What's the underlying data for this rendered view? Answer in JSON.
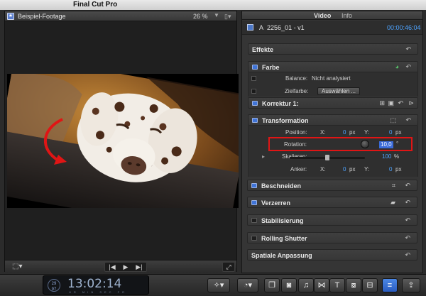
{
  "app": {
    "name": "Final Cut Pro"
  },
  "viewer": {
    "clip_name": "Beispiel-Footage",
    "zoom": "26 %",
    "zoom_arrow": "▼",
    "view_menu": "▯▾",
    "clip_icon": "★"
  },
  "transport": {
    "prev": "|◀",
    "play": "▶",
    "next": "▶|"
  },
  "inspector": {
    "tabs": [
      "Video",
      "Info"
    ],
    "clip": {
      "letter": "A",
      "name": "2256_01 - v1",
      "duration": "00:00:46:04"
    },
    "sections": {
      "effekte": "Effekte",
      "farbe": "Farbe",
      "korrektur": "Korrektur 1:",
      "transformation": "Transformation",
      "beschneiden": "Beschneiden",
      "verzerren": "Verzerren",
      "stabilisierung": "Stabilisierung",
      "rolling_shutter": "Rolling Shutter",
      "spatiale": "Spatiale Anpassung"
    },
    "farbe_params": {
      "balance_label": "Balance:",
      "balance_value": "Nicht analysiert",
      "zielfarbe_label": "Zielfarbe:",
      "zielfarbe_button": "Auswählen ..."
    },
    "transform_params": {
      "position_label": "Position:",
      "position_x_label": "X:",
      "position_x": "0",
      "position_x_unit": "px",
      "position_y_label": "Y:",
      "position_y": "0",
      "position_y_unit": "px",
      "rotation_label": "Rotation:",
      "rotation_value": "10,0",
      "rotation_unit": "°",
      "scale_label": "Skalieren:",
      "scale_value": "100",
      "scale_unit": "%",
      "scale_level": 0.5,
      "anchor_label": "Anker:",
      "anchor_x_label": "X:",
      "anchor_x": "0",
      "anchor_x_unit": "px",
      "anchor_y_label": "Y:",
      "anchor_y": "0",
      "anchor_y_unit": "px"
    },
    "reset_icon": "↶"
  },
  "timecode": {
    "rate": "29",
    "rate_sub": "97",
    "value": "13:02:14",
    "units": "HR MIN SEC FR"
  },
  "colors": {
    "accent_blue": "#3f74d8",
    "highlight_red": "#e01515",
    "timecode_blue": "#4da3ff"
  }
}
